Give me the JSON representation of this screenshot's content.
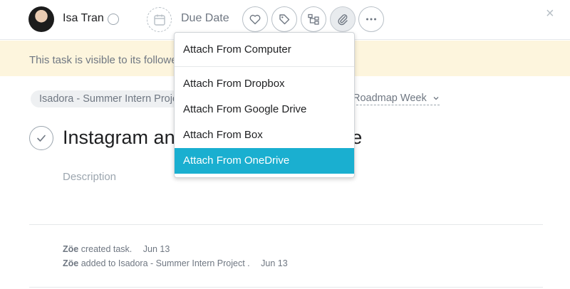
{
  "assignee": {
    "name": "Isa Tran"
  },
  "due_date": {
    "label": "Due Date"
  },
  "toolbar": {
    "buttons": [
      {
        "name": "like-button",
        "icon": "heart-icon"
      },
      {
        "name": "tags-button",
        "icon": "tag-icon"
      },
      {
        "name": "subtasks-button",
        "icon": "subtask-icon"
      },
      {
        "name": "attach-button",
        "icon": "paperclip-icon",
        "active": true
      },
      {
        "name": "more-button",
        "icon": "more-icon"
      }
    ],
    "close_label": "×"
  },
  "banner": {
    "text": "This task is visible to its followers"
  },
  "project": {
    "name": "Isadora - Summer Intern Project",
    "section": "Roadmap Week"
  },
  "task": {
    "title": "Instagram and Facebook Presence",
    "description_placeholder": "Description"
  },
  "attach_menu": {
    "items": [
      {
        "label": "Attach From Computer"
      },
      {
        "label": "Attach From Dropbox"
      },
      {
        "label": "Attach From Google Drive"
      },
      {
        "label": "Attach From Box"
      },
      {
        "label": "Attach From OneDrive",
        "highlighted": true
      }
    ]
  },
  "activity": [
    {
      "user": "Zöe",
      "action": "created task.",
      "date": "Jun 13"
    },
    {
      "user": "Zöe",
      "action": "added to Isadora - Summer Intern Project .",
      "date": "Jun 13"
    }
  ],
  "colors": {
    "highlight": "#1aafd0",
    "banner": "#fdf5dd"
  }
}
